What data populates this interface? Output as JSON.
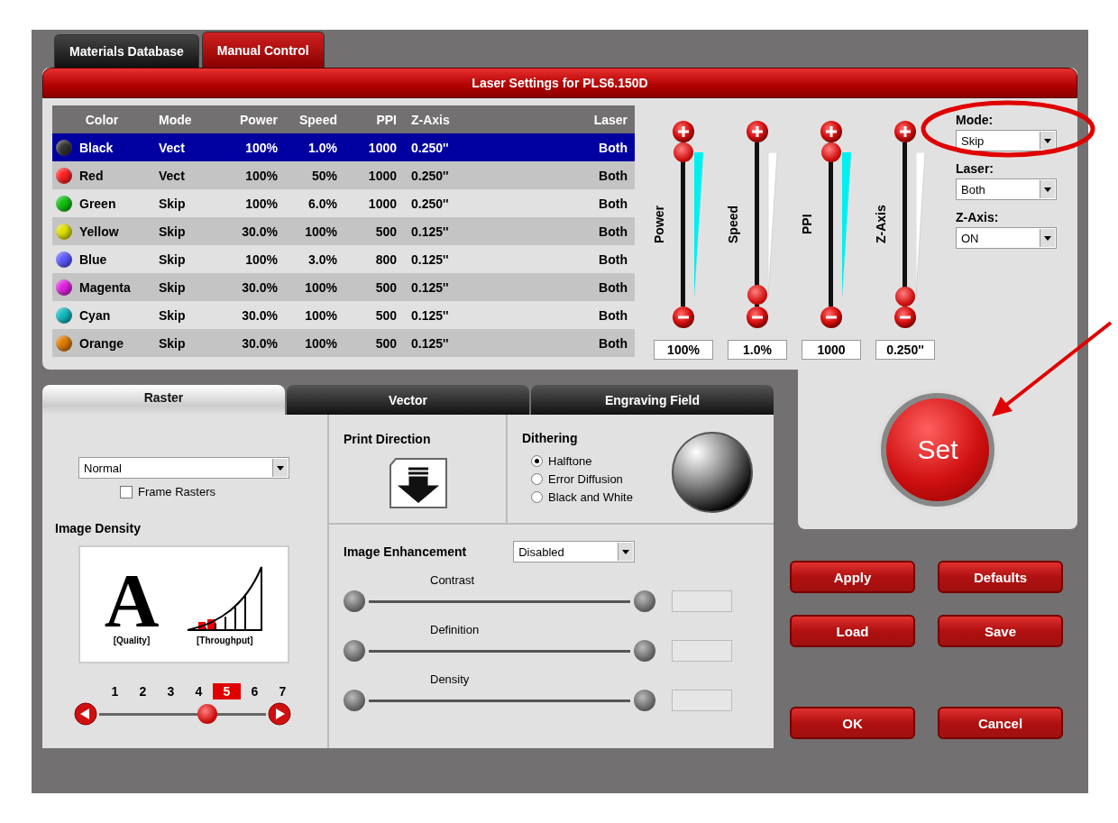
{
  "tabs": [
    {
      "label": "Materials Database",
      "selected": false
    },
    {
      "label": "Manual Control",
      "selected": true
    }
  ],
  "panel_title": "Laser Settings for PLS6.150D",
  "table": {
    "columns": [
      "Color",
      "Mode",
      "Power",
      "Speed",
      "PPI",
      "Z-Axis",
      "Laser"
    ],
    "rows": [
      {
        "color": "#333333",
        "selected": true,
        "cells": [
          "Black",
          "Vect",
          "100%",
          "1.0%",
          "1000",
          "0.250''",
          "Both"
        ]
      },
      {
        "color": "#ff2020",
        "selected": false,
        "cells": [
          "Red",
          "Vect",
          "100%",
          "50%",
          "1000",
          "0.250''",
          "Both"
        ]
      },
      {
        "color": "#10c010",
        "selected": false,
        "cells": [
          "Green",
          "Skip",
          "100%",
          "6.0%",
          "1000",
          "0.250''",
          "Both"
        ]
      },
      {
        "color": "#e0e000",
        "selected": false,
        "cells": [
          "Yellow",
          "Skip",
          "30.0%",
          "100%",
          "500",
          "0.125''",
          "Both"
        ]
      },
      {
        "color": "#5a5aff",
        "selected": false,
        "cells": [
          "Blue",
          "Skip",
          "100%",
          "3.0%",
          "800",
          "0.125''",
          "Both"
        ]
      },
      {
        "color": "#e020e0",
        "selected": false,
        "cells": [
          "Magenta",
          "Skip",
          "30.0%",
          "100%",
          "500",
          "0.125''",
          "Both"
        ]
      },
      {
        "color": "#10b8c0",
        "selected": false,
        "cells": [
          "Cyan",
          "Skip",
          "30.0%",
          "100%",
          "500",
          "0.125''",
          "Both"
        ]
      },
      {
        "color": "#e07a00",
        "selected": false,
        "cells": [
          "Orange",
          "Skip",
          "30.0%",
          "100%",
          "500",
          "0.125''",
          "Both"
        ]
      }
    ]
  },
  "sliders": [
    {
      "label": "Power",
      "level": 1,
      "value": "100%"
    },
    {
      "label": "Speed",
      "level": 0.01,
      "value": "1.0%"
    },
    {
      "label": "PPI",
      "level": 1,
      "value": "1000"
    },
    {
      "label": "Z-Axis",
      "level": 0,
      "value": "0.250''"
    }
  ],
  "settings": [
    {
      "label": "Mode:",
      "value": "Skip"
    },
    {
      "label": "Laser:",
      "value": "Both"
    },
    {
      "label": "Z-Axis:",
      "value": "ON"
    }
  ],
  "set_button": "Set",
  "mode_tabs": [
    {
      "label": "Raster",
      "selected": true
    },
    {
      "label": "Vector",
      "selected": false
    },
    {
      "label": "Engraving Field",
      "selected": false
    }
  ],
  "raster": {
    "mode": "Normal",
    "frame_rasters": {
      "label": "Frame Rasters",
      "checked": false
    },
    "image_density": {
      "title": "Image Density",
      "letter": "A",
      "quality_label": "[Quality]",
      "throughput_label": "[Throughput]",
      "steps": [
        {
          "label": "1",
          "selected": false
        },
        {
          "label": "2",
          "selected": false
        },
        {
          "label": "3",
          "selected": false
        },
        {
          "label": "4",
          "selected": false
        },
        {
          "label": "5",
          "selected": true
        },
        {
          "label": "6",
          "selected": false
        },
        {
          "label": "7",
          "selected": false
        }
      ]
    }
  },
  "print_direction": {
    "title": "Print Direction"
  },
  "dithering": {
    "title": "Dithering",
    "options": [
      {
        "label": "Halftone",
        "selected": true
      },
      {
        "label": "Error Diffusion",
        "selected": false
      },
      {
        "label": "Black and White",
        "selected": false
      }
    ]
  },
  "image_enhancement": {
    "title": "Image Enhancement",
    "value": "Disabled",
    "controls": [
      "Contrast",
      "Definition",
      "Density"
    ]
  },
  "buttons": [
    "Apply",
    "Defaults",
    "Load",
    "Save",
    "OK",
    "Cancel"
  ]
}
